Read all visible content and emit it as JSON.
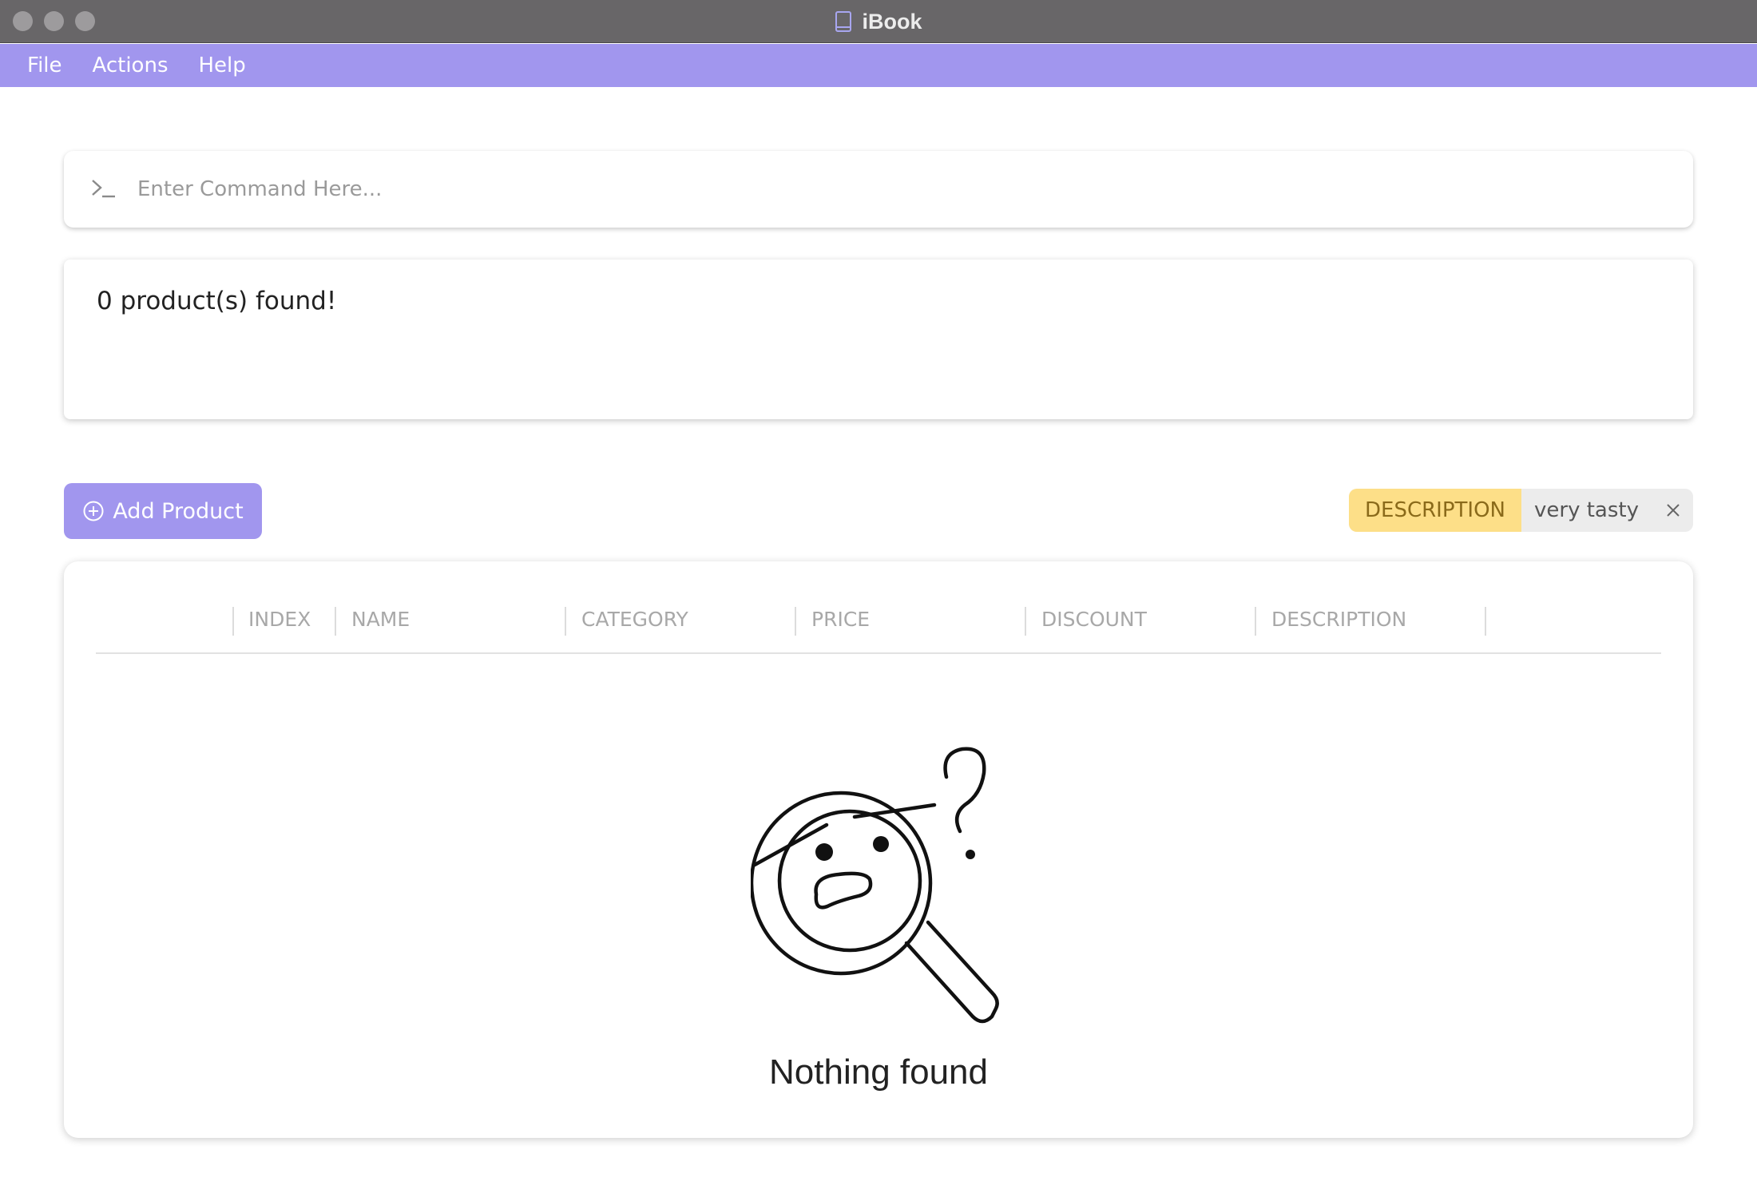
{
  "window": {
    "title": "iBook"
  },
  "menu": {
    "items": [
      "File",
      "Actions",
      "Help"
    ]
  },
  "command": {
    "placeholder": "Enter Command Here..."
  },
  "result": {
    "text": "0 product(s) found!"
  },
  "toolbar": {
    "add_label": "Add Product"
  },
  "filter": {
    "key": "DESCRIPTION",
    "value": "very tasty"
  },
  "table": {
    "columns": [
      "INDEX",
      "NAME",
      "CATEGORY",
      "PRICE",
      "DISCOUNT",
      "DESCRIPTION"
    ]
  },
  "empty": {
    "text": "Nothing found"
  },
  "colors": {
    "accent": "#a196ee",
    "chip_key_bg": "#fddf88",
    "titlebar": "#686668"
  },
  "icons": [
    "book-icon",
    "terminal-prompt-icon",
    "plus-circle-icon",
    "close-icon",
    "magnifier-confused-icon"
  ]
}
